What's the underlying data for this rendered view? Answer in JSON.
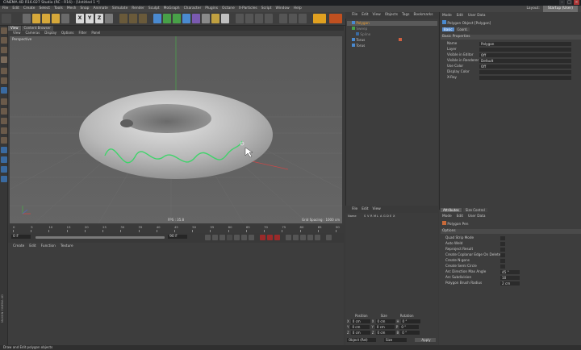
{
  "window": {
    "title": "CINEMA 4D R16.027 Studio (RC - R16) - [Untitled 1 *]"
  },
  "menu": [
    "File",
    "Edit",
    "Create",
    "Select",
    "Tools",
    "Mesh",
    "Snap",
    "Animate",
    "Simulate",
    "Render",
    "Sculpt",
    "MoGraph",
    "Character",
    "Plugins",
    "Octane",
    "X-Particles",
    "Script",
    "Window",
    "Help"
  ],
  "layout": {
    "label": "Layout:",
    "value": "Startup (User)"
  },
  "toolbar": {
    "x": "X",
    "y": "Y",
    "z": "Z"
  },
  "viewport": {
    "tabs": [
      "View",
      "Content Browser"
    ],
    "menu": [
      "View",
      "Cameras",
      "Display",
      "Options",
      "Filter",
      "Panel"
    ],
    "name": "Perspective",
    "fps": "FPS : 35.8",
    "grid_spacing": "Grid Spacing : 1000 cm"
  },
  "timeline": {
    "ticks": [
      "0",
      "5",
      "10",
      "15",
      "20",
      "25",
      "30",
      "35",
      "40",
      "45",
      "50",
      "55",
      "60",
      "65",
      "70",
      "75",
      "80",
      "85",
      "90"
    ],
    "start": "0 F",
    "current": "0 F",
    "end": "90 F",
    "end2": "90 F"
  },
  "material": {
    "menu": [
      "Create",
      "Edit",
      "Function",
      "Texture"
    ],
    "side_label": "MAXON CINEMA 4D"
  },
  "objects": {
    "menu": [
      "File",
      "Edit",
      "View",
      "Objects",
      "Tags",
      "Bookmarks"
    ],
    "rows": [
      {
        "name": "Polygon"
      },
      {
        "name": "Sweep"
      },
      {
        "name": "Spline"
      },
      {
        "name": "Torus"
      },
      {
        "name": "Torus"
      }
    ]
  },
  "layers": {
    "menu": [
      "File",
      "Edit",
      "View"
    ],
    "columns": [
      "Name",
      "S",
      "V",
      "R",
      "M",
      "L",
      "A",
      "G",
      "D",
      "E",
      "X"
    ]
  },
  "coordinates": {
    "headers": [
      "Position",
      "Size",
      "Rotation"
    ],
    "rows": [
      {
        "axis": "X",
        "pos": "0 cm",
        "size": "0 cm",
        "rot_label": "H",
        "rot": "0 °"
      },
      {
        "axis": "Y",
        "pos": "0 cm",
        "size": "0 cm",
        "rot_label": "P",
        "rot": "0 °"
      },
      {
        "axis": "Z",
        "pos": "0 cm",
        "size": "0 cm",
        "rot_label": "B",
        "rot": "0 °"
      }
    ],
    "mode": "Object (Rel)",
    "size_mode": "Size",
    "apply": "Apply"
  },
  "attributes": {
    "menu": [
      "Mode",
      "Edit",
      "User Data"
    ],
    "object_title": "Polygon Object [Polygon]",
    "tabs": [
      "Basic",
      "Coord."
    ],
    "section": "Basic Properties",
    "props": [
      {
        "label": "Name",
        "value": "Polygon"
      },
      {
        "label": "Layer",
        "value": ""
      },
      {
        "label": "Visible in Editor",
        "value": "Off"
      },
      {
        "label": "Visible in Renderer",
        "value": "Default"
      },
      {
        "label": "Use Color",
        "value": "Off"
      },
      {
        "label": "Display Color",
        "value": ""
      },
      {
        "label": "X-Ray",
        "value": ""
      }
    ]
  },
  "attributes2": {
    "tabs": [
      "Attributes",
      "Size Control"
    ],
    "menu": [
      "Mode",
      "Edit",
      "User Data"
    ],
    "title": "Polygon Pen",
    "section": "Options",
    "options": [
      {
        "label": "Quad Strip Mode",
        "value": ""
      },
      {
        "label": "Auto Weld",
        "value": ""
      },
      {
        "label": "Reproject Result",
        "value": ""
      },
      {
        "label": "Create Coplanar Edge On Delete",
        "value": ""
      },
      {
        "label": "Create N-gons",
        "value": ""
      },
      {
        "label": "Create Semi Circle",
        "value": ""
      },
      {
        "label": "Arc Direction Max Angle",
        "value": "45 °"
      },
      {
        "label": "Arc Subdivision",
        "value": "10"
      },
      {
        "label": "Polygon Brush Radius",
        "value": "2 cm"
      }
    ]
  },
  "status": {
    "text": "Draw and Edit polygon objects"
  },
  "colors": {
    "spline": "#3fd36a",
    "axis_x": "#c84848",
    "axis_y": "#4aa84a",
    "axis_z": "#5068c0"
  }
}
